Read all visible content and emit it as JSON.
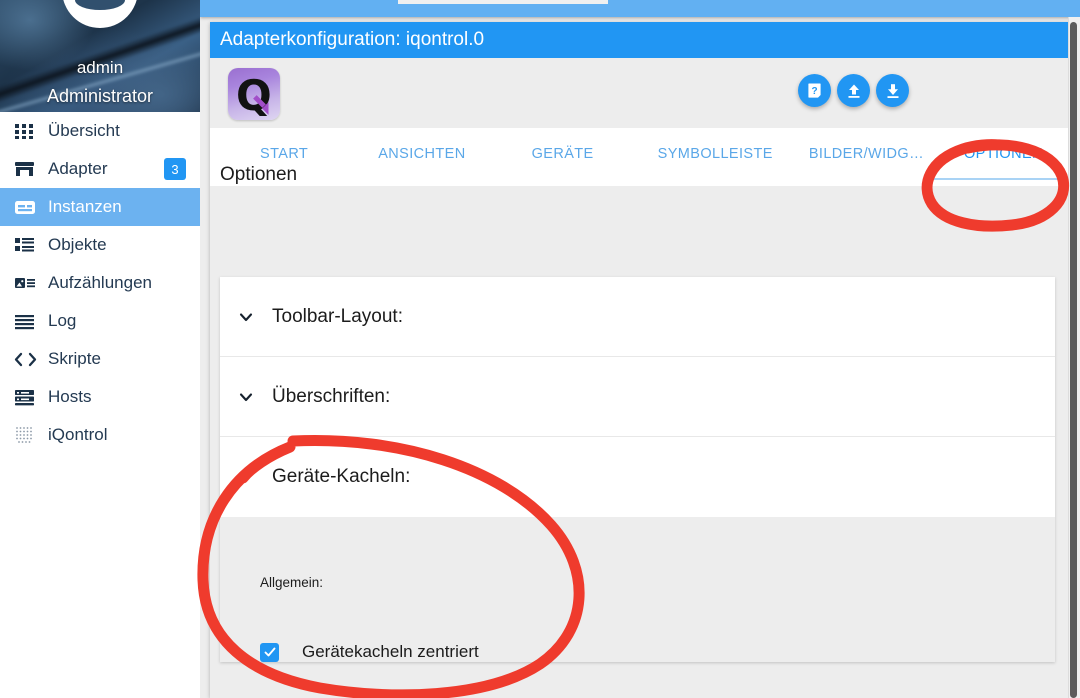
{
  "sidebar": {
    "user": {
      "name": "admin",
      "role": "Administrator",
      "avatar_icon": "user-avatar-icon"
    },
    "items": [
      {
        "label": "Übersicht",
        "icon": "apps-grid-icon",
        "active": false,
        "badge": null
      },
      {
        "label": "Adapter",
        "icon": "store-icon",
        "active": false,
        "badge": "3"
      },
      {
        "label": "Instanzen",
        "icon": "card-icon",
        "active": true,
        "badge": null
      },
      {
        "label": "Objekte",
        "icon": "list-icon",
        "active": false,
        "badge": null
      },
      {
        "label": "Aufzählungen",
        "icon": "image-list-icon",
        "active": false,
        "badge": null
      },
      {
        "label": "Log",
        "icon": "lines-icon",
        "active": false,
        "badge": null
      },
      {
        "label": "Skripte",
        "icon": "code-icon",
        "active": false,
        "badge": null
      },
      {
        "label": "Hosts",
        "icon": "server-icon",
        "active": false,
        "badge": null
      },
      {
        "label": "iQontrol",
        "icon": "dotted-grid-icon",
        "active": false,
        "badge": null
      }
    ]
  },
  "dialog": {
    "title": "Adapterkonfiguration: iqontrol.0",
    "app_icon": "iqontrol-q-icon",
    "toolbar_buttons": [
      {
        "name": "help-button",
        "icon": "help-doc-icon",
        "title": ""
      },
      {
        "name": "upload-button",
        "icon": "upload-icon",
        "title": ""
      },
      {
        "name": "download-button",
        "icon": "download-icon",
        "title": ""
      }
    ],
    "tabs": [
      {
        "label": "START",
        "active": false
      },
      {
        "label": "ANSICHTEN",
        "active": false
      },
      {
        "label": "GERÄTE",
        "active": false
      },
      {
        "label": "SYMBOLLEISTE",
        "active": false
      },
      {
        "label": "BILDER/WIDG…",
        "active": false
      },
      {
        "label": "OPTIONEN",
        "active": true
      }
    ],
    "page_heading": "Optionen",
    "accordion": [
      {
        "title": "Toolbar-Layout:",
        "expanded": false,
        "chevron": "chevron-down-icon"
      },
      {
        "title": "Überschriften:",
        "expanded": false,
        "chevron": "chevron-down-icon"
      },
      {
        "title": "Geräte-Kacheln:",
        "expanded": true,
        "chevron": "chevron-down-icon"
      }
    ],
    "geraete_kacheln_panel": {
      "sublabel": "Allgemein:",
      "checkbox": {
        "label": "Gerätekacheln zentriert",
        "checked": true
      }
    }
  },
  "colors": {
    "accent_blue": "#2196f3",
    "tab_blue": "#5aa7e8",
    "sidebar_active": "#6cb2f0",
    "annotation_red": "#ef3b2d",
    "page_bg": "#ededed",
    "panel_bg": "#ededed",
    "card_bg": "#ffffff"
  },
  "annotations": [
    {
      "name": "annotation-circle-optionen-tab",
      "shape": "hand-drawn-ellipse",
      "color": "#ef3b2d"
    },
    {
      "name": "annotation-circle-geraete-kacheln",
      "shape": "hand-drawn-ellipse",
      "color": "#ef3b2d"
    }
  ]
}
